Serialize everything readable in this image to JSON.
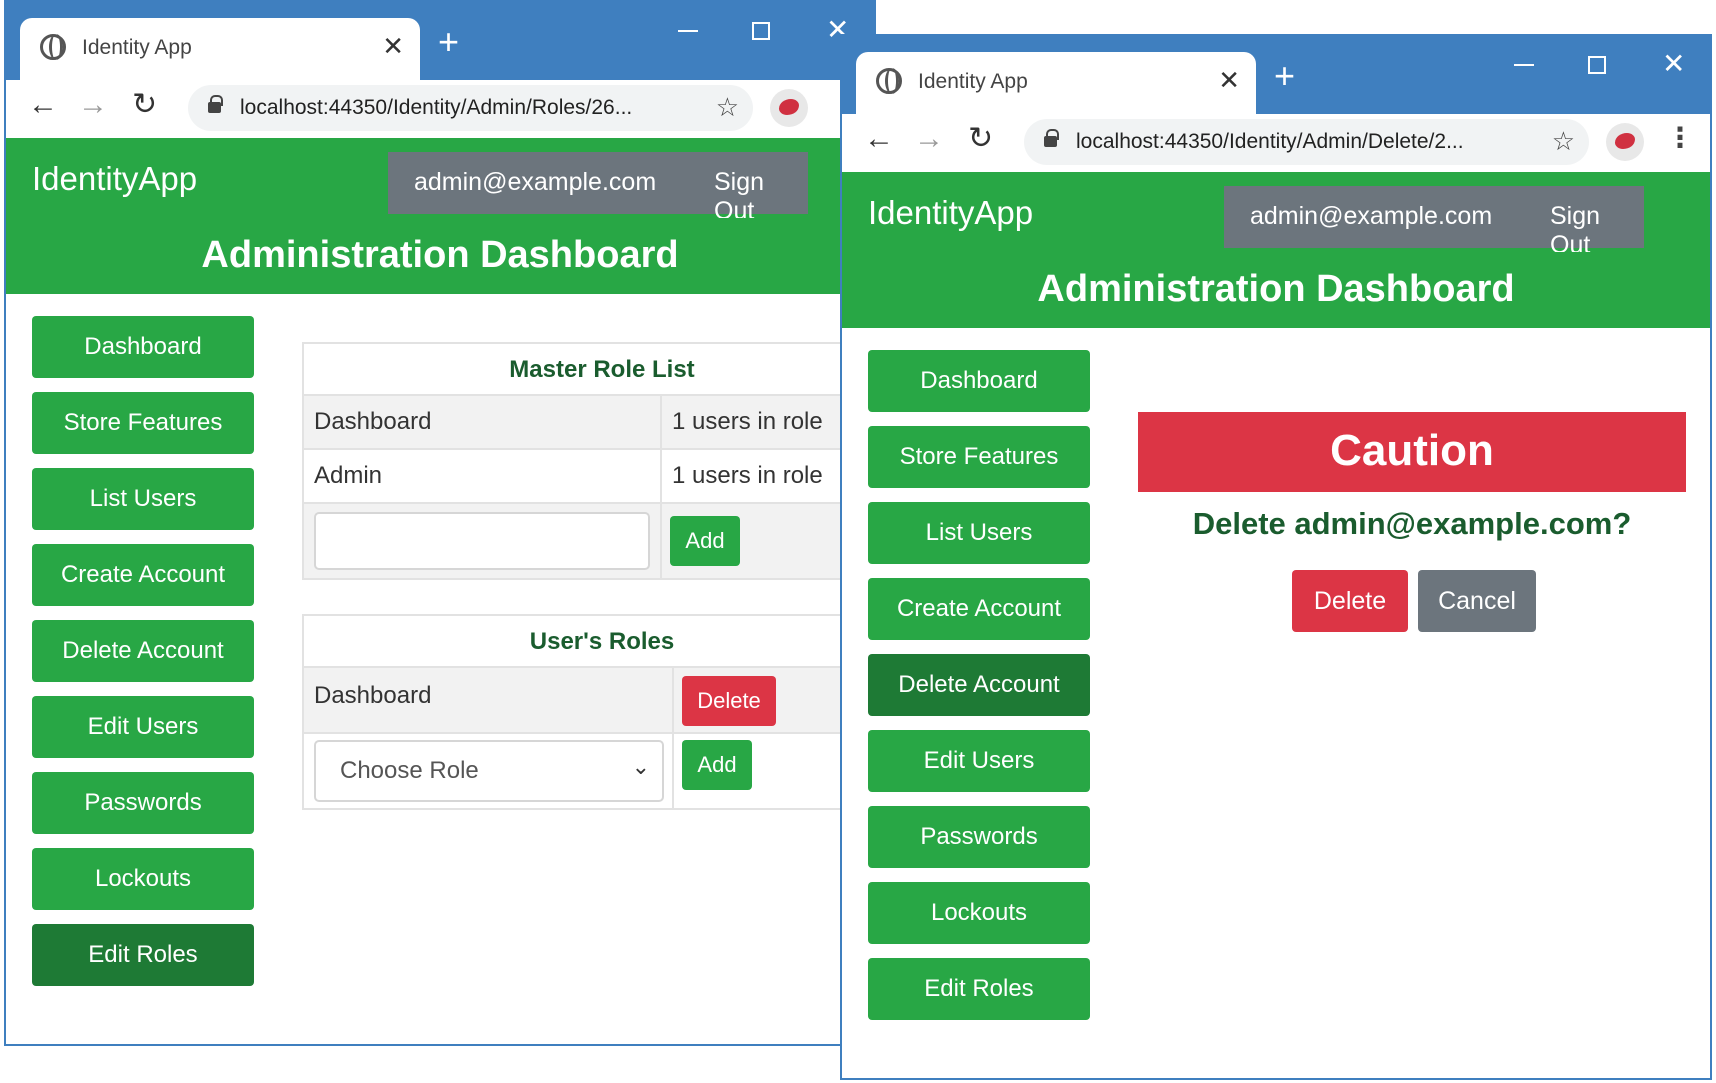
{
  "window1": {
    "tab_title": "Identity App",
    "url": "localhost:44350/Identity/Admin/Roles/26...",
    "brand": "IdentityApp",
    "user_email": "admin@example.com",
    "sign_out": "Sign Out",
    "page_title": "Administration Dashboard",
    "sidebar": [
      {
        "label": "Dashboard",
        "active": false
      },
      {
        "label": "Store Features",
        "active": false
      },
      {
        "label": "List Users",
        "active": false
      },
      {
        "label": "Create Account",
        "active": false
      },
      {
        "label": "Delete Account",
        "active": false
      },
      {
        "label": "Edit Users",
        "active": false
      },
      {
        "label": "Passwords",
        "active": false
      },
      {
        "label": "Lockouts",
        "active": false
      },
      {
        "label": "Edit Roles",
        "active": true
      }
    ],
    "master_roles": {
      "header": "Master Role List",
      "rows": [
        {
          "name": "Dashboard",
          "count": "1 users in role"
        },
        {
          "name": "Admin",
          "count": "1 users in role"
        }
      ],
      "new_role_value": "",
      "add_label": "Add"
    },
    "user_roles": {
      "header": "User's Roles",
      "rows": [
        {
          "name": "Dashboard",
          "delete_label": "Delete"
        }
      ],
      "select_value": "Choose Role",
      "add_label": "Add"
    }
  },
  "window2": {
    "tab_title": "Identity App",
    "url": "localhost:44350/Identity/Admin/Delete/2...",
    "brand": "IdentityApp",
    "user_email": "admin@example.com",
    "sign_out": "Sign Out",
    "page_title": "Administration Dashboard",
    "sidebar": [
      {
        "label": "Dashboard",
        "active": false
      },
      {
        "label": "Store Features",
        "active": false
      },
      {
        "label": "List Users",
        "active": false
      },
      {
        "label": "Create Account",
        "active": false
      },
      {
        "label": "Delete Account",
        "active": true
      },
      {
        "label": "Edit Users",
        "active": false
      },
      {
        "label": "Passwords",
        "active": false
      },
      {
        "label": "Lockouts",
        "active": false
      },
      {
        "label": "Edit Roles",
        "active": false
      }
    ],
    "caution_title": "Caution",
    "question": "Delete admin@example.com?",
    "delete_label": "Delete",
    "cancel_label": "Cancel"
  },
  "colors": {
    "chrome_blue": "#3f7fbf",
    "success_green": "#28a745",
    "active_green": "#1e7a35",
    "danger_red": "#dc3545",
    "secondary_gray": "#6c757d"
  },
  "icons": {
    "favicon": "globe-icon",
    "close_tab": "close-icon",
    "new_tab": "plus-icon",
    "back": "arrow-left-icon",
    "forward": "arrow-right-icon",
    "reload": "reload-icon",
    "lock": "lock-icon",
    "bookmark": "star-icon",
    "menu": "kebab-icon",
    "select_arrow": "chevron-down-icon"
  }
}
